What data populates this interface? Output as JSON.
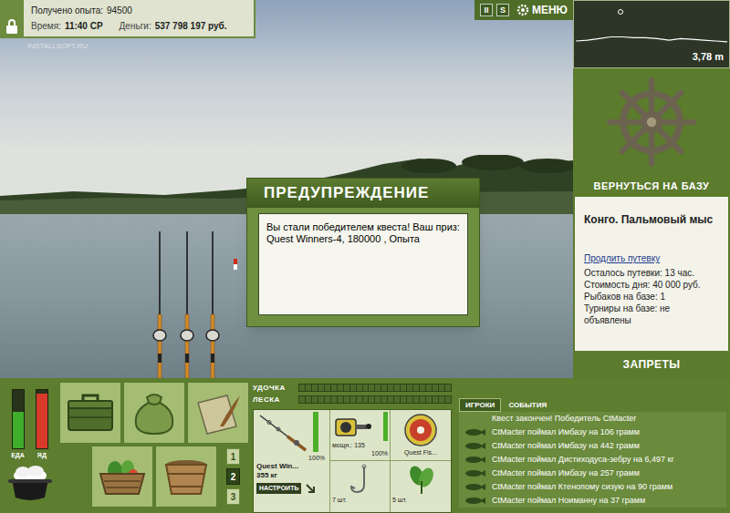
{
  "hud": {
    "experience_label": "Получено опыта:",
    "experience": "94500",
    "time_label": "Время:",
    "time": "11:40 СР",
    "money_label": "Деньги:",
    "money": "537 798 197 руб."
  },
  "watermark": "INSTALLSOFT.RU",
  "top_buttons": [
    {
      "label": "II",
      "kind": "toggle"
    },
    {
      "label": "S",
      "kind": "toggle"
    },
    {
      "label": "МЕНЮ",
      "kind": "menu"
    }
  ],
  "depth": {
    "reading": "3,78 m",
    "bottom_profile": [
      4.0,
      3.9,
      3.7,
      3.5,
      3.5,
      3.6,
      3.6,
      3.7,
      3.9,
      3.7,
      3.8,
      3.9,
      4.0,
      4.1
    ],
    "marker_level": 0.3
  },
  "location": {
    "return_button": "ВЕРНУТЬСЯ НА БАЗУ",
    "name": "Конго. Пальмовый мыс",
    "extend_link": "Продлить путевку",
    "details": [
      "Осталось путевки: 13 час.",
      "Стоимость дня: 40 000 руб.",
      "Рыбаков на базе: 1",
      "Турниры на базе: не объявлены"
    ],
    "bans_button": "ЗАПРЕТЫ"
  },
  "dialog": {
    "title": "ПРЕДУПРЕЖДЕНИЕ",
    "message": "Вы стали победителем квеста! Ваш приз: Quest Winners-4, 180000 , Опыта"
  },
  "meters": [
    {
      "label": "ЕДА",
      "level": 0.62,
      "color": "#3fae2a"
    },
    {
      "label": "ЯД",
      "level": 0.93,
      "color": "#d83a2a"
    }
  ],
  "inventory_tabs": [
    {
      "label": "1",
      "selected": false
    },
    {
      "label": "2",
      "selected": true
    },
    {
      "label": "3",
      "selected": false
    }
  ],
  "gauges": [
    {
      "label": "УДОЧКА",
      "level": 0
    },
    {
      "label": "ЛЕСКА",
      "level": 0
    }
  ],
  "tackle": {
    "rod": {
      "name": "Quest Win...",
      "load": "355 кг",
      "condition": "100%",
      "level": 1
    },
    "setup_button": "НАСТРОИТЬ",
    "reel": {
      "power": "мощн.: 135",
      "condition": "100%",
      "level": 1
    },
    "line": {
      "name": "Quest Fis..."
    },
    "hook": {
      "count": "7 шт."
    },
    "bait": {
      "count": "5 шт."
    }
  },
  "feed": {
    "tabs": [
      {
        "label": "ИГРОКИ",
        "selected": true
      },
      {
        "label": "СОБЫТИЯ",
        "selected": false
      }
    ],
    "items": [
      {
        "kind": "notice",
        "text": "Квест закончен! Победитель CtMacter"
      },
      {
        "kind": "catch",
        "text": "CtMacter поймал Имбазу на 106 грамм"
      },
      {
        "kind": "catch",
        "text": "CtMacter поймал Имбазу на 442 грамм"
      },
      {
        "kind": "catch",
        "text": "CtMacter поймал Дистиходуса-зебру на 6,497 кг"
      },
      {
        "kind": "catch",
        "text": "CtMacter поймал Имбазу на 257 грамм"
      },
      {
        "kind": "catch",
        "text": "CtMacter поймал Ктенопому сизую на 90 грамм"
      },
      {
        "kind": "catch",
        "text": "CtMacter поймал Ноиманну на 37 грамм"
      }
    ]
  }
}
